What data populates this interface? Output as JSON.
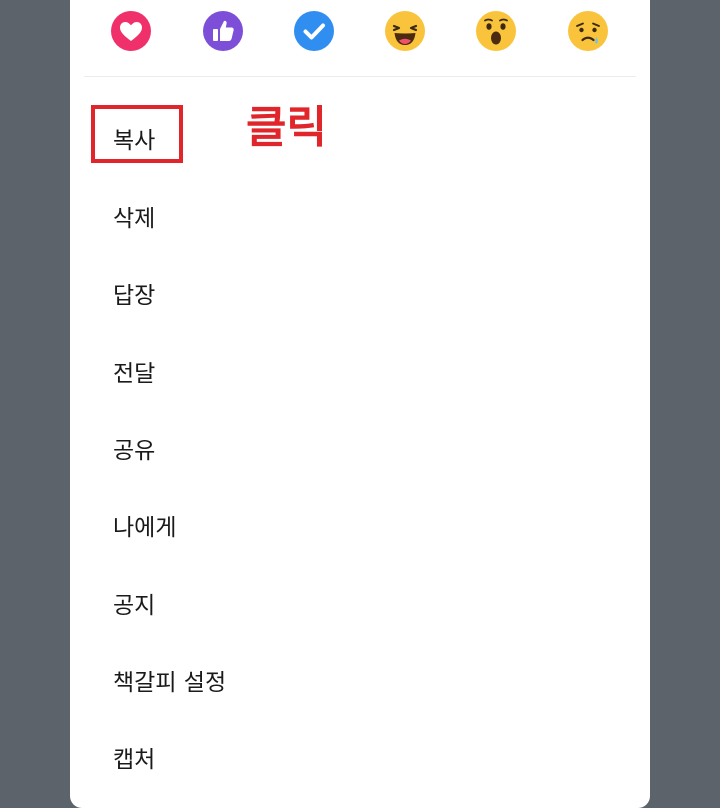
{
  "reactions": [
    {
      "name": "heart",
      "color": "#f0306a"
    },
    {
      "name": "thumbs-up",
      "color": "#7d4fd8"
    },
    {
      "name": "check",
      "color": "#2f8ef0"
    },
    {
      "name": "laughing-face",
      "color": "#f9c33c"
    },
    {
      "name": "surprised-face",
      "color": "#f9c33c"
    },
    {
      "name": "sad-face",
      "color": "#f9c33c"
    }
  ],
  "menu": {
    "items": [
      {
        "label": "복사"
      },
      {
        "label": "삭제"
      },
      {
        "label": "답장"
      },
      {
        "label": "전달"
      },
      {
        "label": "공유"
      },
      {
        "label": "나에게"
      },
      {
        "label": "공지"
      },
      {
        "label": "책갈피 설정"
      },
      {
        "label": "캡처"
      }
    ]
  },
  "annotation": {
    "text": "클릭",
    "color": "#e0262b"
  }
}
